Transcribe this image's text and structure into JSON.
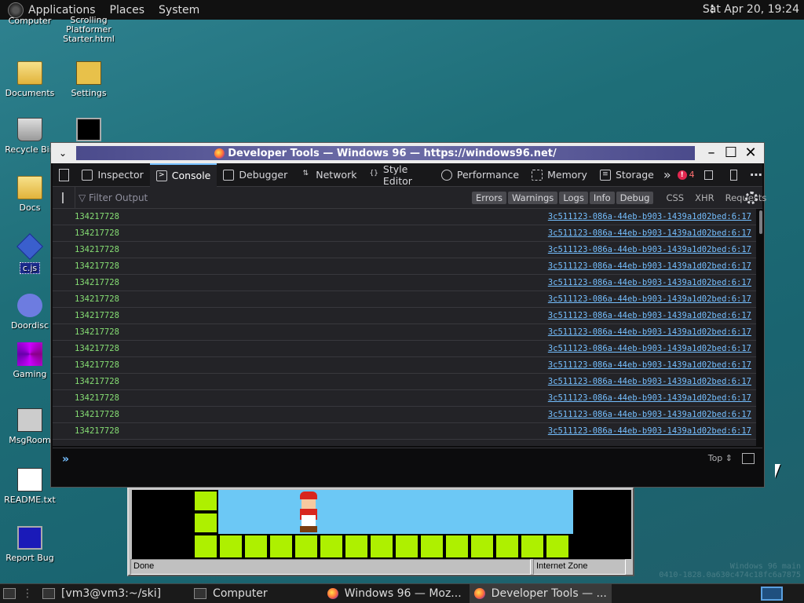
{
  "top_panel": {
    "applications": "Applications",
    "places": "Places",
    "system": "System",
    "clock": "Sat Apr 20, 19:24"
  },
  "desktop": {
    "icons": [
      {
        "label": "Computer"
      },
      {
        "label": "Scrolling Platformer Starter.html"
      },
      {
        "label": "Documents"
      },
      {
        "label": "Settings"
      },
      {
        "label": "Recycle Bin"
      },
      {
        "label": "Docs"
      },
      {
        "label": "c.js"
      },
      {
        "label": "Doordisc"
      },
      {
        "label": "Gaming"
      },
      {
        "label": "MsgRoom"
      },
      {
        "label": "README.txt"
      },
      {
        "label": "Report Bug"
      }
    ]
  },
  "devtools": {
    "window_title": "Developer Tools — Windows 96 — https://windows96.net/",
    "tabs": [
      {
        "label": "Inspector"
      },
      {
        "label": "Console"
      },
      {
        "label": "Debugger"
      },
      {
        "label": "Network"
      },
      {
        "label": "Style Editor"
      },
      {
        "label": "Performance"
      },
      {
        "label": "Memory"
      },
      {
        "label": "Storage"
      }
    ],
    "error_count": "4",
    "filter_placeholder": "Filter Output",
    "levels": [
      "Errors",
      "Warnings",
      "Logs",
      "Info",
      "Debug"
    ],
    "extras": [
      "CSS",
      "XHR",
      "Requests"
    ],
    "log_rows": [
      {
        "value": "134217728",
        "source": "3c511123-086a-44eb-b903-1439a1d02bed:6:17"
      },
      {
        "value": "134217728",
        "source": "3c511123-086a-44eb-b903-1439a1d02bed:6:17"
      },
      {
        "value": "134217728",
        "source": "3c511123-086a-44eb-b903-1439a1d02bed:6:17"
      },
      {
        "value": "134217728",
        "source": "3c511123-086a-44eb-b903-1439a1d02bed:6:17"
      },
      {
        "value": "134217728",
        "source": "3c511123-086a-44eb-b903-1439a1d02bed:6:17"
      },
      {
        "value": "134217728",
        "source": "3c511123-086a-44eb-b903-1439a1d02bed:6:17"
      },
      {
        "value": "134217728",
        "source": "3c511123-086a-44eb-b903-1439a1d02bed:6:17"
      },
      {
        "value": "134217728",
        "source": "3c511123-086a-44eb-b903-1439a1d02bed:6:17"
      },
      {
        "value": "134217728",
        "source": "3c511123-086a-44eb-b903-1439a1d02bed:6:17"
      },
      {
        "value": "134217728",
        "source": "3c511123-086a-44eb-b903-1439a1d02bed:6:17"
      },
      {
        "value": "134217728",
        "source": "3c511123-086a-44eb-b903-1439a1d02bed:6:17"
      },
      {
        "value": "134217728",
        "source": "3c511123-086a-44eb-b903-1439a1d02bed:6:17"
      },
      {
        "value": "134217728",
        "source": "3c511123-086a-44eb-b903-1439a1d02bed:6:17"
      },
      {
        "value": "134217728",
        "source": "3c511123-086a-44eb-b903-1439a1d02bed:6:17"
      }
    ],
    "context": "Top ⇕"
  },
  "browser": {
    "status_left": "Done",
    "status_right": "Internet Zone"
  },
  "taskbar": {
    "items": [
      {
        "label": "[vm3@vm3:~/ski]"
      },
      {
        "label": "Computer"
      },
      {
        "label": "Windows 96 — Moz..."
      },
      {
        "label": "Developer Tools — ..."
      }
    ]
  },
  "watermark": {
    "line1": "Windows 96 main",
    "line2": "0410-1828.0a630c474c18fc6a7875"
  },
  "colors": {
    "accent_blue": "#75bfff",
    "log_green": "#86de74",
    "error_red": "#e22850"
  }
}
